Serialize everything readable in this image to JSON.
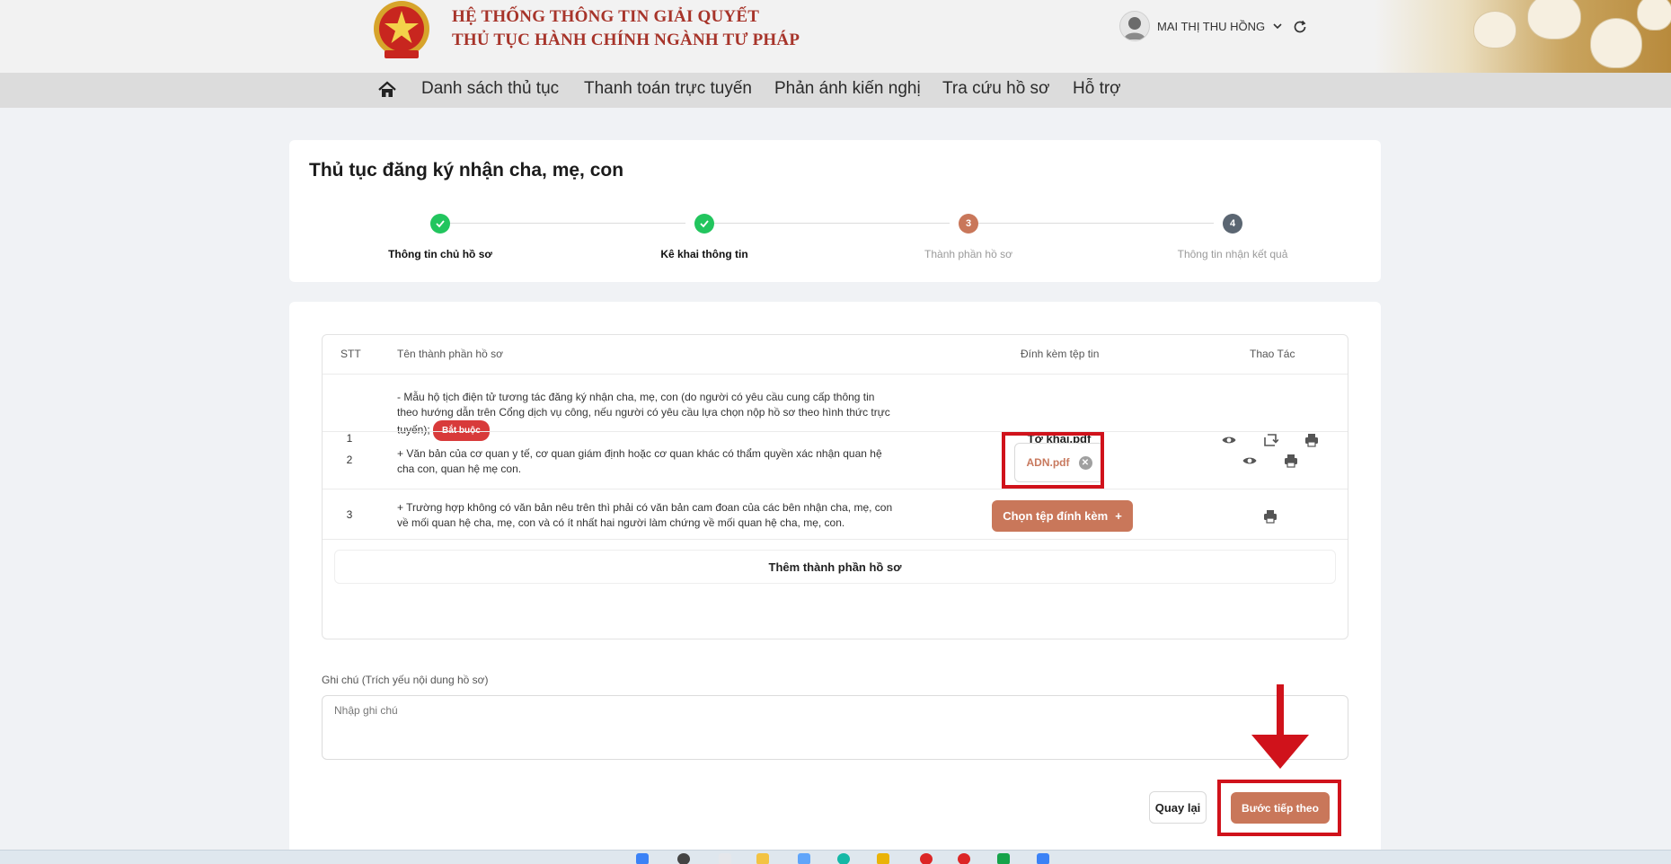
{
  "header": {
    "brand_line1": "HỆ THỐNG THÔNG TIN GIẢI QUYẾT",
    "brand_line2": "THỦ TỤC HÀNH CHÍNH NGÀNH TƯ PHÁP",
    "user_name": "MAI THỊ THU HỒNG"
  },
  "nav": {
    "items": [
      "Danh sách thủ tục",
      "Thanh toán trực tuyến",
      "Phản ánh kiến nghị",
      "Tra cứu hồ sơ",
      "Hỗ trợ"
    ]
  },
  "procedure": {
    "title": "Thủ tục đăng ký nhận cha, mẹ, con",
    "steps": [
      {
        "label": "Thông tin chủ hồ sơ",
        "status": "done"
      },
      {
        "label": "Kê khai thông tin",
        "status": "done"
      },
      {
        "number": "3",
        "label": "Thành phần hồ sơ",
        "status": "current"
      },
      {
        "number": "4",
        "label": "Thông tin nhận kết quả",
        "status": "pending"
      }
    ]
  },
  "table": {
    "headers": [
      "STT",
      "Tên thành phần hồ sơ",
      "Đính kèm tệp tin",
      "Thao Tác"
    ],
    "rows": [
      {
        "stt": "1",
        "name_lines": [
          "- Mẫu hộ tịch điện tử tương tác đăng ký nhận cha, mẹ, con (do người có yêu cầu cung cấp thông tin",
          "theo hướng dẫn trên Cổng dịch vụ công, nếu người có yêu cầu lựa chọn nộp hồ sơ theo hình thức trực",
          "tuyến);"
        ],
        "required_badge": "Bắt buộc",
        "file": "Tờ khai.pdf"
      },
      {
        "stt": "2",
        "name_lines": [
          "+ Văn bản của cơ quan y tế, cơ quan giám định hoặc cơ quan khác có thẩm quyền xác nhận quan hệ",
          "cha con, quan hệ mẹ con."
        ],
        "file": "ADN.pdf"
      },
      {
        "stt": "3",
        "name_lines": [
          "+ Trường hợp không có văn bản nêu trên thì phải có văn bản cam đoan của các bên nhận cha, mẹ, con",
          "về mối quan hệ cha, mẹ, con và có ít nhất hai người làm chứng về mối quan hệ cha, mẹ, con."
        ],
        "attach_button": "Chọn tệp đính kèm"
      }
    ],
    "add_row_label": "Thêm thành phần hồ sơ"
  },
  "note": {
    "label": "Ghi chú (Trích yếu nội dung hồ sơ)",
    "placeholder": "Nhập ghi chú",
    "value": ""
  },
  "actions": {
    "back_label": "Quay lại",
    "next_label": "Bước tiếp theo"
  },
  "colors": {
    "brand_red": "#a7342a",
    "accent": "#c9775a",
    "done_green": "#22c55e",
    "pending_gray": "#5b6672",
    "annotation_red": "#d0121b"
  }
}
